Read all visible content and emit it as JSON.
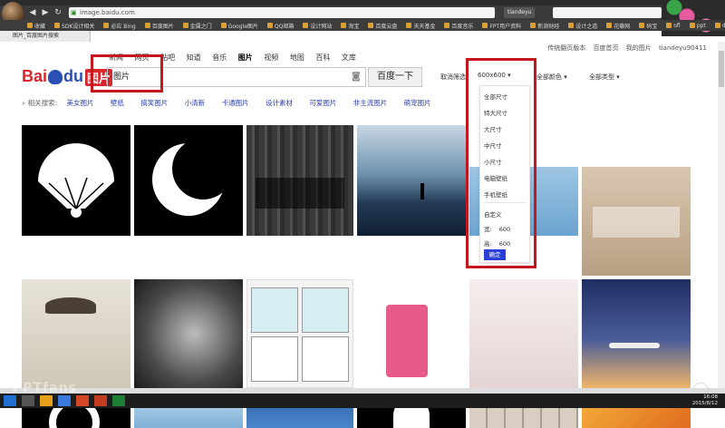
{
  "browser": {
    "url": "image.baidu.com",
    "tab_title": "图片_百度图片搜索",
    "profile_button": "tiandeyu",
    "bookmarks": [
      "收藏",
      "SDK设计相关",
      "必应 Bing",
      "百度图片",
      "金属之门",
      "Google图片",
      "QQ邮箱",
      "设计网站",
      "淘宝",
      "百度云盘",
      "天天基金",
      "百度音乐",
      "FPT用户资料",
      "新浪财经",
      "设计之道",
      "花瓣网",
      "码宝",
      "ofl",
      "ppt",
      "dribbble",
      "UI"
    ]
  },
  "page": {
    "toplinks": [
      "传统翻页版本",
      "百度首页",
      "我的图片",
      "tiandeyu90411"
    ],
    "nav": [
      {
        "label": "新闻"
      },
      {
        "label": "网页"
      },
      {
        "label": "贴吧"
      },
      {
        "label": "知道"
      },
      {
        "label": "音乐"
      },
      {
        "label": "图片",
        "active": true
      },
      {
        "label": "视频"
      },
      {
        "label": "地图"
      },
      {
        "label": "百科"
      },
      {
        "label": "文库"
      }
    ],
    "logo": {
      "bai": "Bai",
      "du": "du",
      "tu": "图片"
    },
    "search": {
      "value": "图片",
      "button": "百度一下"
    },
    "filters": {
      "cancel": "取消筛选",
      "size": "600x600 ▾",
      "color": "全部颜色 ▾",
      "type": "全部类型 ▾"
    },
    "related": {
      "label": "相关搜索:",
      "items": [
        "美女图片",
        "壁纸",
        "搞笑图片",
        "小清新",
        "卡通图片",
        "设计素材",
        "可爱图片",
        "非主流图片",
        "萌宠图片"
      ]
    },
    "size_dropdown": {
      "items": [
        "全部尺寸",
        "特大尺寸",
        "大尺寸",
        "中尺寸",
        "小尺寸",
        "电脑壁纸",
        "手机壁纸"
      ],
      "custom_label": "自定义",
      "width_label": "宽:",
      "width_value": "600",
      "height_label": "高:",
      "height_value": "600",
      "confirm": "确定"
    },
    "colors": {
      "accent": "#2a3fd8",
      "highlight": "#c3171d",
      "brand_red": "#d8262c",
      "brand_blue": "#2a4fb5"
    }
  },
  "taskbar": {
    "time": "16:08",
    "date": "2015/8/12"
  },
  "watermark": "PPTfans"
}
